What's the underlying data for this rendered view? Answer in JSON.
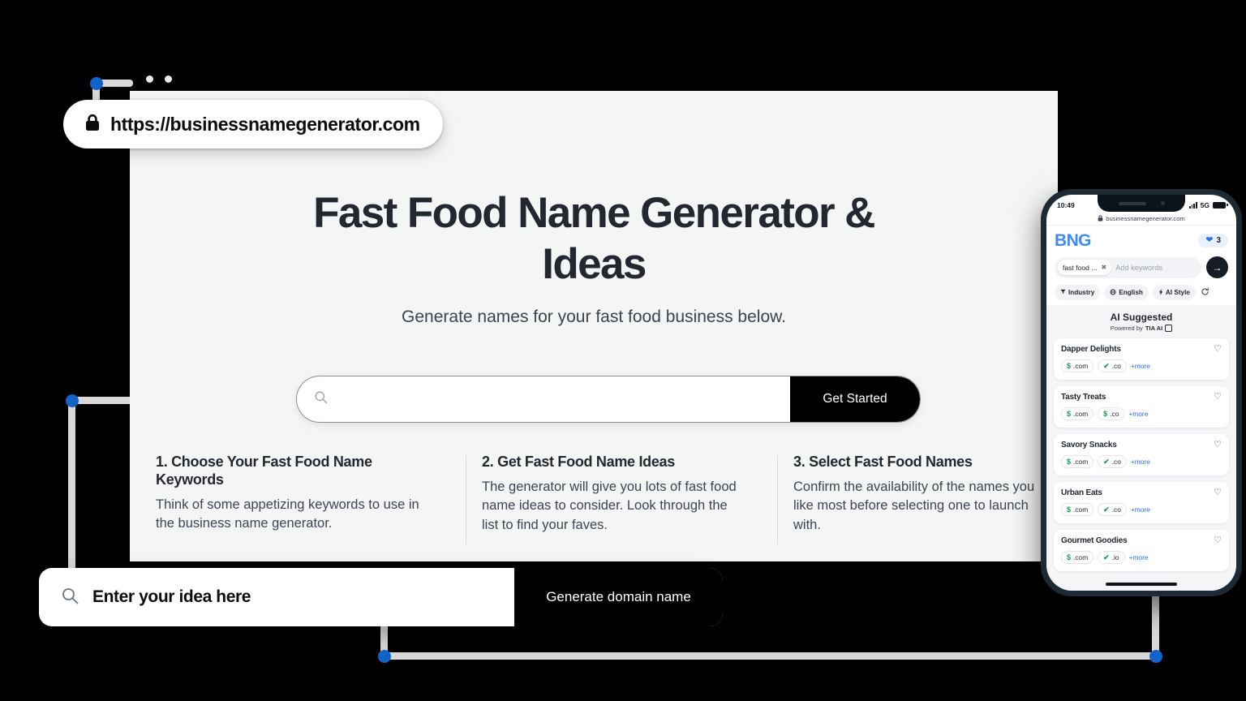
{
  "browser": {
    "url": "https://businessnamegenerator.com",
    "lock_icon": "lock-icon",
    "dots": [
      "dot-1",
      "dot-2"
    ]
  },
  "hero": {
    "title": "Fast Food Name Generator & Ideas",
    "subtitle": "Generate names for your fast food business below."
  },
  "search": {
    "icon": "search-icon",
    "placeholder": "",
    "value": "",
    "button_label": "Get Started"
  },
  "steps": [
    {
      "title": "1. Choose Your Fast Food Name Keywords",
      "body": "Think of some appetizing keywords to use in the business name generator."
    },
    {
      "title": "2. Get Fast Food Name Ideas",
      "body": "The generator will give you lots of fast food name ideas to consider. Look through the list to find your faves."
    },
    {
      "title": "3. Select Fast Food Names",
      "body": "Confirm the availability of the names you like most before selecting one to launch with."
    }
  ],
  "bottom_bar": {
    "icon": "search-icon",
    "placeholder": "Enter your idea here",
    "value": "",
    "button_label": "Generate domain name"
  },
  "phone": {
    "status": {
      "time": "10:49",
      "signal_icon": "cellular-bars-icon",
      "network": "5G",
      "battery_icon": "battery-icon"
    },
    "url": "businessnamegenerator.com",
    "url_lock_icon": "lock-icon",
    "logo": "BNG",
    "favorites": {
      "icon": "heart-filled-icon",
      "count": "3"
    },
    "keywords": {
      "chip_label": "fast food ...",
      "chip_remove_icon": "close-icon",
      "placeholder": "Add keywords",
      "submit_icon": "arrow-right-icon"
    },
    "filters": [
      {
        "icon": "funnel-icon",
        "label": "Industry"
      },
      {
        "icon": "globe-icon",
        "label": "English"
      },
      {
        "icon": "bolt-icon",
        "label": "AI Style"
      }
    ],
    "refresh_icon": "refresh-icon",
    "ai_section": {
      "title": "AI Suggested",
      "powered_prefix": "Powered by",
      "powered_brand": "TIA AI",
      "chip_icon": "ai-chip-icon"
    },
    "results": [
      {
        "name": "Dapper Delights",
        "heart_icon": "heart-outline-icon",
        "tlds": [
          {
            "mark": "$",
            "label": ".com"
          },
          {
            "mark": "✔",
            "label": ".co"
          }
        ],
        "more": "+more"
      },
      {
        "name": "Tasty Treats",
        "heart_icon": "heart-outline-icon",
        "tlds": [
          {
            "mark": "$",
            "label": ".com"
          },
          {
            "mark": "$",
            "label": ".co"
          }
        ],
        "more": "+more"
      },
      {
        "name": "Savory Snacks",
        "heart_icon": "heart-outline-icon",
        "tlds": [
          {
            "mark": "$",
            "label": ".com"
          },
          {
            "mark": "✔",
            "label": ".co"
          }
        ],
        "more": "+more"
      },
      {
        "name": "Urban Eats",
        "heart_icon": "heart-outline-icon",
        "tlds": [
          {
            "mark": "$",
            "label": ".com"
          },
          {
            "mark": "✔",
            "label": ".co"
          }
        ],
        "more": "+more"
      },
      {
        "name": "Gourmet Goodies",
        "heart_icon": "heart-outline-icon",
        "tlds": [
          {
            "mark": "$",
            "label": ".com"
          },
          {
            "mark": "✔",
            "label": ".io"
          }
        ],
        "more": "+more"
      }
    ]
  },
  "colors": {
    "accent_blue": "#1163c9",
    "brand_blue": "#3f8bf5",
    "link_blue": "#2d6ff0",
    "available_green": "#16a34a",
    "page_bg": "#f4f5f5",
    "black": "#000000"
  }
}
